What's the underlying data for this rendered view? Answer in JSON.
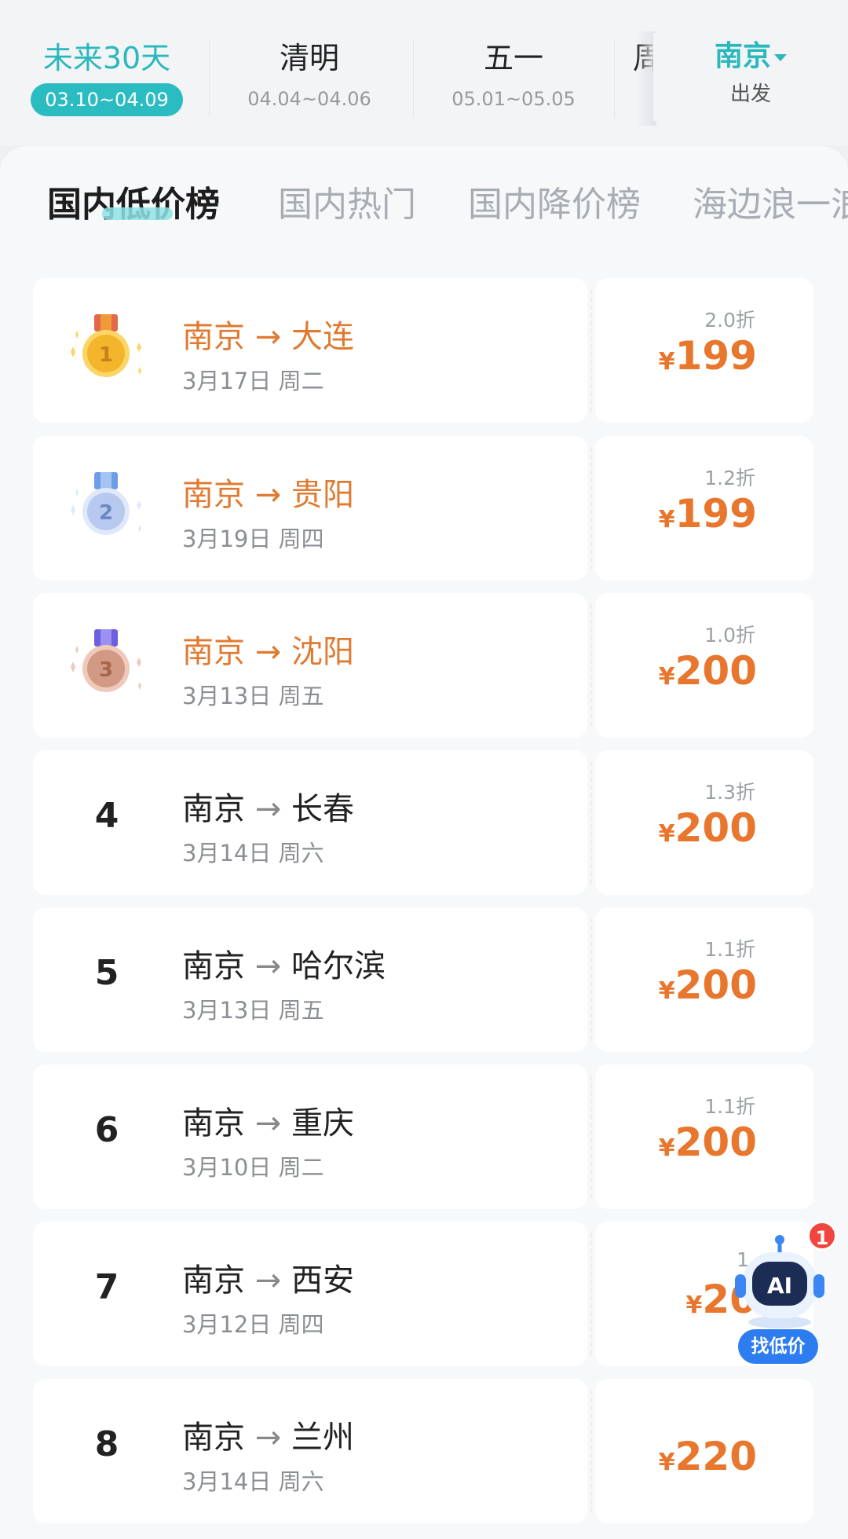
{
  "date_tabs": [
    {
      "title": "未来30天",
      "range": "03.10~04.09",
      "active": true
    },
    {
      "title": "清明",
      "range": "04.04~04.06",
      "active": false
    },
    {
      "title": "五一",
      "range": "05.01~05.05",
      "active": false
    },
    {
      "title": "周",
      "range": "",
      "active": false
    }
  ],
  "departure": {
    "city": "南京",
    "label": "出发"
  },
  "category_tabs": [
    {
      "label": "国内低价榜",
      "active": true
    },
    {
      "label": "国内热门",
      "active": false
    },
    {
      "label": "国内降价榜",
      "active": false
    },
    {
      "label": "海边浪一浪",
      "active": false
    }
  ],
  "currency": "¥",
  "routes": [
    {
      "rank": "1",
      "medal": "gold",
      "route_from": "南京",
      "route_to": "大连",
      "date": "3月17日 周二",
      "discount": "2.0折",
      "price": "199"
    },
    {
      "rank": "2",
      "medal": "silver",
      "route_from": "南京",
      "route_to": "贵阳",
      "date": "3月19日 周四",
      "discount": "1.2折",
      "price": "199"
    },
    {
      "rank": "3",
      "medal": "bronze",
      "route_from": "南京",
      "route_to": "沈阳",
      "date": "3月13日 周五",
      "discount": "1.0折",
      "price": "200"
    },
    {
      "rank": "4",
      "medal": "",
      "route_from": "南京",
      "route_to": "长春",
      "date": "3月14日 周六",
      "discount": "1.3折",
      "price": "200"
    },
    {
      "rank": "5",
      "medal": "",
      "route_from": "南京",
      "route_to": "哈尔滨",
      "date": "3月13日 周五",
      "discount": "1.1折",
      "price": "200"
    },
    {
      "rank": "6",
      "medal": "",
      "route_from": "南京",
      "route_to": "重庆",
      "date": "3月10日 周二",
      "discount": "1.1折",
      "price": "200"
    },
    {
      "rank": "7",
      "medal": "",
      "route_from": "南京",
      "route_to": "西安",
      "date": "3月12日 周四",
      "discount": "1.",
      "price": "20"
    },
    {
      "rank": "8",
      "medal": "",
      "route_from": "南京",
      "route_to": "兰州",
      "date": "3月14日 周六",
      "discount": "",
      "price": "220"
    }
  ],
  "ai_assistant": {
    "icon_text": "AI",
    "label": "找低价",
    "badge": "1"
  },
  "colors": {
    "accent": "#2bb8bd",
    "price": "#e8762d",
    "top3_route": "#e07a30",
    "gold": "#f3b52c",
    "silver": "#9db5e8",
    "bronze": "#d9a08a",
    "ai_blue": "#2d7cf0"
  }
}
